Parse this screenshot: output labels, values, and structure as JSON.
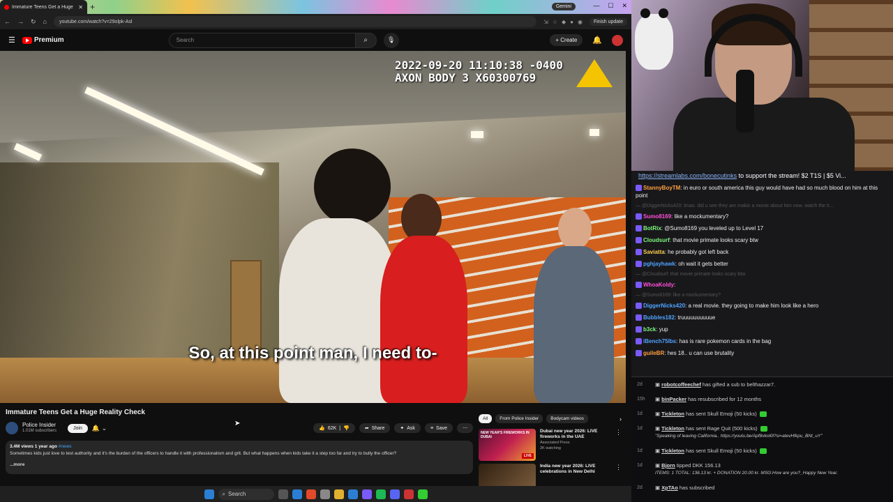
{
  "browser": {
    "tab_title": "Immature Teens Get a Huge",
    "gemini_label": "Gemini",
    "url": "youtube.com/watch?v=29olpk-Asl",
    "update_label": "Finish update"
  },
  "yt": {
    "brand": "Premium",
    "search_placeholder": "Search",
    "create_label": "Create"
  },
  "video": {
    "timestamp_line1": "2022-09-20 11:10:38 -0400",
    "timestamp_line2": "AXON BODY 3 X60300769",
    "subtitle": "So, at this point man, I need to-",
    "title": "Immature Teens Get a Huge Reality Check",
    "channel": "Police Insider",
    "subscribers": "1.01M subscribers",
    "join_label": "Join",
    "likes": "62K",
    "share_label": "Share",
    "ask_label": "Ask",
    "save_label": "Save",
    "views_meta": "3.4M views  1 year ago",
    "hashtag": "#news",
    "description": "Sometimes kids just love to test authority and it's the burden of the officers to handle it with professionalism and grit. But what happens when kids take it a step too far and try to bully the officer?",
    "more_label": "...more"
  },
  "recs": {
    "chips": [
      "All",
      "From Police Insider",
      "Bodycam videos"
    ],
    "items": [
      {
        "title": "Dubai new year 2026: LIVE fireworks in the UAE",
        "channel": "Associated Press",
        "meta": "2K watching",
        "thumb_text": "NEW YEAR'S FIREWORKS IN DUBAI",
        "live": "LIVE"
      },
      {
        "title": "India new year 2026: LIVE celebrations in New Delhi",
        "channel": "",
        "meta": "",
        "thumb_text": "",
        "live": ""
      }
    ]
  },
  "chat": {
    "banner_link": "https://streamlabs.com/bonecutinks",
    "banner_text": " to support the stream! $2 T1S | $5 Vi...",
    "messages": [
      {
        "user": "StannyBoyTM",
        "color": "#ff9f40",
        "text": "in euro or south america this guy would have had so much blood on him at this point"
      },
      {
        "user": "",
        "color": "#555",
        "text": "— @DiggerNicks420: lmao. did u see they are makin a movie about him now. watch the tr...",
        "reply": true
      },
      {
        "user": "Sumo8169",
        "color": "#ff4fd8",
        "text": "like a mockumentary?"
      },
      {
        "user": "BotRix",
        "color": "#7cfc7c",
        "text": "@Sumo8169 you leveled up to Level 17"
      },
      {
        "user": "Cloudsurf",
        "color": "#7cfc7c",
        "text": "that movie primate looks scary btw"
      },
      {
        "user": "Saviatta",
        "color": "#ffd24f",
        "text": "he probably got left back"
      },
      {
        "user": "pghjayhawk",
        "color": "#4fa3ff",
        "text": "oh wait it gets better"
      },
      {
        "user": "",
        "color": "#555",
        "text": "— @Cloudsurf: that movie primate looks scary btw",
        "reply": true
      },
      {
        "user": "WhoaKoldy",
        "color": "#ff4fd8",
        "text": ""
      },
      {
        "user": "",
        "color": "#555",
        "text": "— @Sumo8169: like a mockumentary?",
        "reply": true
      },
      {
        "user": "DiggerNicks420",
        "color": "#4fa3ff",
        "text": "a real movie. they going to make him look like a hero"
      },
      {
        "user": "Bubbles182",
        "color": "#4fa3ff",
        "text": "truuuuuuuuuue"
      },
      {
        "user": "b3ck",
        "color": "#7cfc7c",
        "text": "yup"
      },
      {
        "user": "iBench75lbs",
        "color": "#4fa3ff",
        "text": "has is rare pokemon cards in the bag"
      },
      {
        "user": "guileBR",
        "color": "#ff9f40",
        "text": "hes 18.. u can use brutality"
      }
    ]
  },
  "events": [
    {
      "time": "2d",
      "name": "robotcoffeechef",
      "text": " has gifted a sub to ",
      "target": "belthazzar7.",
      "extra": ""
    },
    {
      "time": "15h",
      "name": "binPacker",
      "text": " has resubscribed for 12 months",
      "target": "",
      "extra": ""
    },
    {
      "time": "1d",
      "name": "Tickleton",
      "text": " has sent Skull Emoji (50 kicks)",
      "target": "",
      "extra": ""
    },
    {
      "time": "1d",
      "name": "Tickleton",
      "text": " has sent Rage Quit (500 kicks)",
      "target": "",
      "extra": "\"Speaking of leaving California.. https://youtu.be/Apf8vkol0l?si=atevHfkpu_BNt_uY\""
    },
    {
      "time": "1d",
      "name": "Tickleton",
      "text": " has sent Skull Emoji (50 kicks)",
      "target": "",
      "extra": ""
    },
    {
      "time": "1d",
      "name": "Bjorn",
      "text": " tipped DKK 156.13",
      "target": "",
      "extra": "ITEMS: 1 TOTAL: 136.13 kr. + DONATION 20.00 kr. MSG:How are you?_Happy New Year."
    },
    {
      "time": "2d",
      "name": "XpTAo",
      "text": " has subscribed",
      "target": "",
      "extra": ""
    }
  ],
  "taskbar": {
    "search_label": "Search"
  }
}
